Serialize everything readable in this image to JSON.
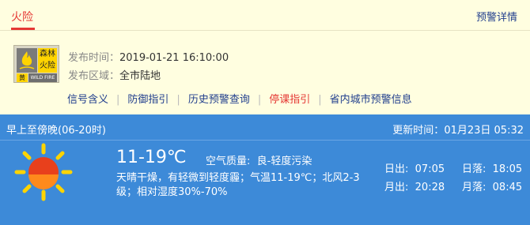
{
  "tabs": {
    "active_label": "火险",
    "details_label": "预警详情"
  },
  "warning": {
    "badge": {
      "name_line1": "森林",
      "name_line2": "火险",
      "level": "黄",
      "en": "WILD FIRE",
      "icon": "fire-icon",
      "color": "#ffd400"
    },
    "issue_time_label": "发布时间：",
    "issue_time": "2019-01-21 16:10:00",
    "area_label": "发布区域：",
    "area": "全市陆地",
    "links": [
      "信号含义",
      "防御指引",
      "历史预警查询",
      "停课指引",
      "省内城市预警信息"
    ]
  },
  "weather": {
    "period": "早上至傍晚(06-20时)",
    "update_label": "更新时间：",
    "update_time": "01月23日 05:32",
    "icon": "sun-icon",
    "temp": "11-19℃",
    "aq_label": "空气质量:",
    "aq_value": "良-轻度污染",
    "description": "天晴干燥，有轻微到轻度霾；气温11-19℃；北风2-3级；相对湿度30%-70%",
    "sunrise_label": "日出:",
    "sunrise": "07:05",
    "sunset_label": "日落:",
    "sunset": "18:05",
    "moonrise_label": "月出:",
    "moonrise": "20:28",
    "moonset_label": "月落:",
    "moonset": "08:45",
    "bg_color": "#3d8ad8"
  }
}
